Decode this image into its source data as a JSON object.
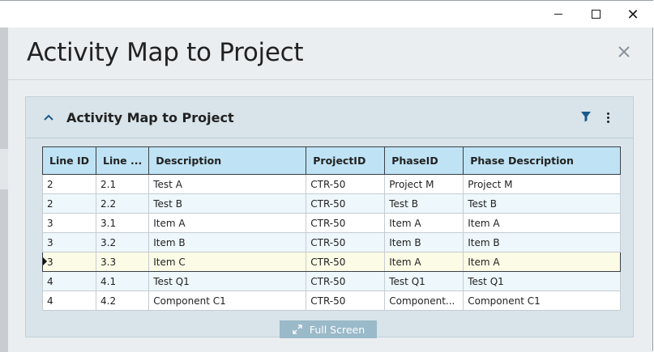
{
  "dialog": {
    "title": "Activity Map to Project"
  },
  "panel": {
    "title": "Activity Map to Project",
    "icons": {
      "collapse": "chevron-up-icon",
      "filter": "filter-icon",
      "more": "more-vertical-icon"
    }
  },
  "table": {
    "columns": [
      "Line ID",
      "Line ...",
      "Description",
      "ProjectID",
      "PhaseID",
      "Phase Description"
    ],
    "rows": [
      [
        "2",
        "2.1",
        "Test A",
        "CTR-50",
        "Project M",
        "Project M"
      ],
      [
        "2",
        "2.2",
        "Test B",
        "CTR-50",
        "Test B",
        "Test B"
      ],
      [
        "3",
        "3.1",
        "Item A",
        "CTR-50",
        "Item A",
        "Item A"
      ],
      [
        "3",
        "3.2",
        "Item B",
        "CTR-50",
        "Item B",
        "Item B"
      ],
      [
        "3",
        "3.3",
        "Item C",
        "CTR-50",
        "Item A",
        "Item A"
      ],
      [
        "4",
        "4.1",
        "Test Q1",
        "CTR-50",
        "Test Q1",
        "Test Q1"
      ],
      [
        "4",
        "4.2",
        "Component C1",
        "CTR-50",
        "Component...",
        "Component C1"
      ]
    ],
    "selected_row_index": 4
  },
  "footer": {
    "fullscreen_label": "Full Screen"
  },
  "colors": {
    "header_bg": "#bfe3f4",
    "accent": "#1a5a8a",
    "selected_row": "#fbfbe6",
    "fullscreen_bg": "#9ab9c9"
  }
}
